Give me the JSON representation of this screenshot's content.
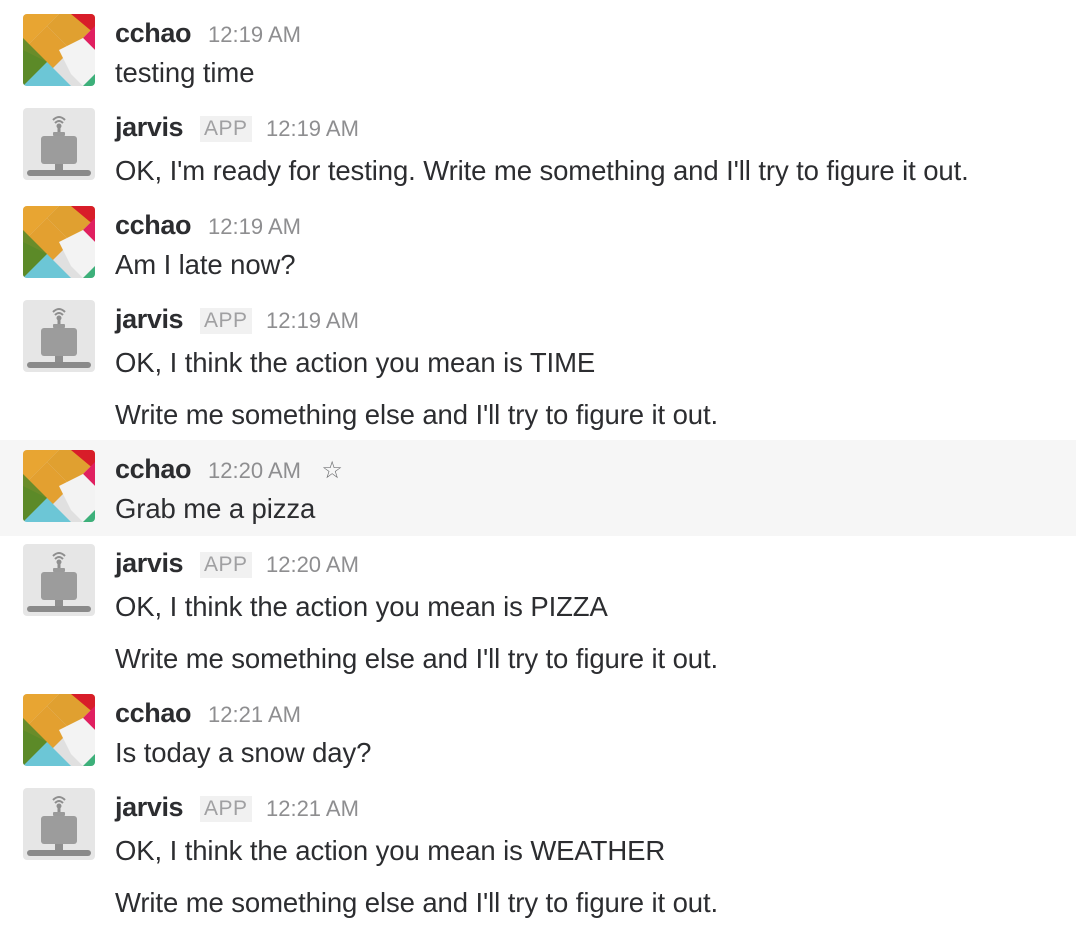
{
  "messages": [
    {
      "user": "cchao",
      "time": "12:19 AM",
      "lines": [
        "testing time"
      ]
    },
    {
      "user": "jarvis",
      "badge": "APP",
      "time": "12:19 AM",
      "lines": [
        "OK, I'm ready for testing. Write me something and I'll try to figure it out."
      ]
    },
    {
      "user": "cchao",
      "time": "12:19 AM",
      "lines": [
        "Am I late now?"
      ]
    },
    {
      "user": "jarvis",
      "badge": "APP",
      "time": "12:19 AM",
      "lines": [
        "OK, I think the action you mean is TIME",
        "Write me something else and I'll try to figure it out."
      ]
    },
    {
      "user": "cchao",
      "time": "12:20 AM",
      "star": "☆",
      "lines": [
        "Grab me a pizza"
      ]
    },
    {
      "user": "jarvis",
      "badge": "APP",
      "time": "12:20 AM",
      "lines": [
        "OK, I think the action you mean is PIZZA",
        "Write me something else and I'll try to figure it out."
      ]
    },
    {
      "user": "cchao",
      "time": "12:21 AM",
      "lines": [
        "Is today a snow day?"
      ]
    },
    {
      "user": "jarvis",
      "badge": "APP",
      "time": "12:21 AM",
      "lines": [
        "OK, I think the action you mean is WEATHER",
        "Write me something else and I'll try to figure it out."
      ]
    }
  ],
  "colors": {
    "highlight_bg": "#f6f6f6",
    "name": "#2c2d30",
    "timestamp": "#8e8e90",
    "badge_text": "#a0a0a2",
    "badge_bg": "#f1f1f1"
  },
  "icons": {
    "cchao_avatar": "colorful-diamond-avatar-icon",
    "jarvis_avatar": "robot-avatar-icon",
    "star": "star-outline-icon"
  }
}
